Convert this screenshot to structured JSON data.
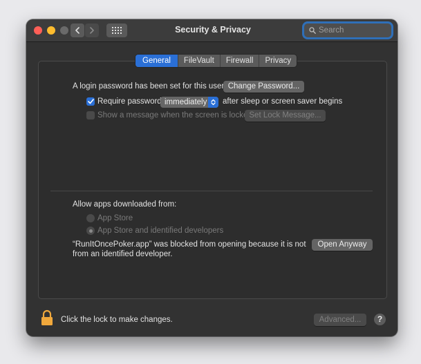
{
  "window": {
    "title": "Security & Privacy",
    "search_placeholder": "Search"
  },
  "colors": {
    "accent": "#2a6fd6",
    "close": "#ff5f57",
    "minimize": "#febc2e",
    "maximize": "#6a6a6a",
    "lock": "#f0a83c"
  },
  "icons": {
    "back": "chevron-left-icon",
    "forward": "chevron-right-icon",
    "show_all": "grid-icon",
    "search": "search-icon",
    "lock": "lock-icon"
  },
  "tabs": [
    {
      "label": "General",
      "active": true
    },
    {
      "label": "FileVault",
      "active": false
    },
    {
      "label": "Firewall",
      "active": false
    },
    {
      "label": "Privacy",
      "active": false
    }
  ],
  "general": {
    "password_text": "A login password has been set for this user",
    "change_password_label": "Change Password...",
    "require_password_label": "Require password",
    "require_password_checked": true,
    "require_password_value": "immediately",
    "after_sleep_text": "after sleep or screen saver begins",
    "show_message_label": "Show a message when the screen is locked",
    "show_message_checked": false,
    "set_lock_message_label": "Set Lock Message..."
  },
  "downloads": {
    "heading": "Allow apps downloaded from:",
    "options": [
      {
        "label": "App Store",
        "selected": false
      },
      {
        "label": "App Store and identified developers",
        "selected": true
      }
    ],
    "blocked_line1": "“RunItOncePoker.app” was blocked from opening because it is not",
    "blocked_line2": "from an identified developer.",
    "open_anyway_label": "Open Anyway"
  },
  "footer": {
    "lock_text": "Click the lock to make changes.",
    "advanced_label": "Advanced...",
    "help_label": "?"
  }
}
